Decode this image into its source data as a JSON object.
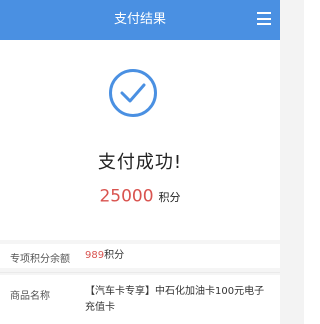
{
  "header": {
    "title": "支付结果",
    "menu_icon": "menu-icon"
  },
  "result": {
    "status_icon": "check-circle-icon",
    "message": "支付成功!",
    "points_amount": "25000",
    "points_unit": "积分"
  },
  "details": {
    "balance_label": "专项积分余额",
    "balance_value": "989",
    "balance_unit": "积分",
    "product_label": "商品名称",
    "product_value": "【汽车卡专享】中石化加油卡100元电子充值卡"
  },
  "colors": {
    "header_bg": "#4a90e2",
    "accent_red": "#d9534f",
    "icon_blue": "#4a90e2"
  }
}
